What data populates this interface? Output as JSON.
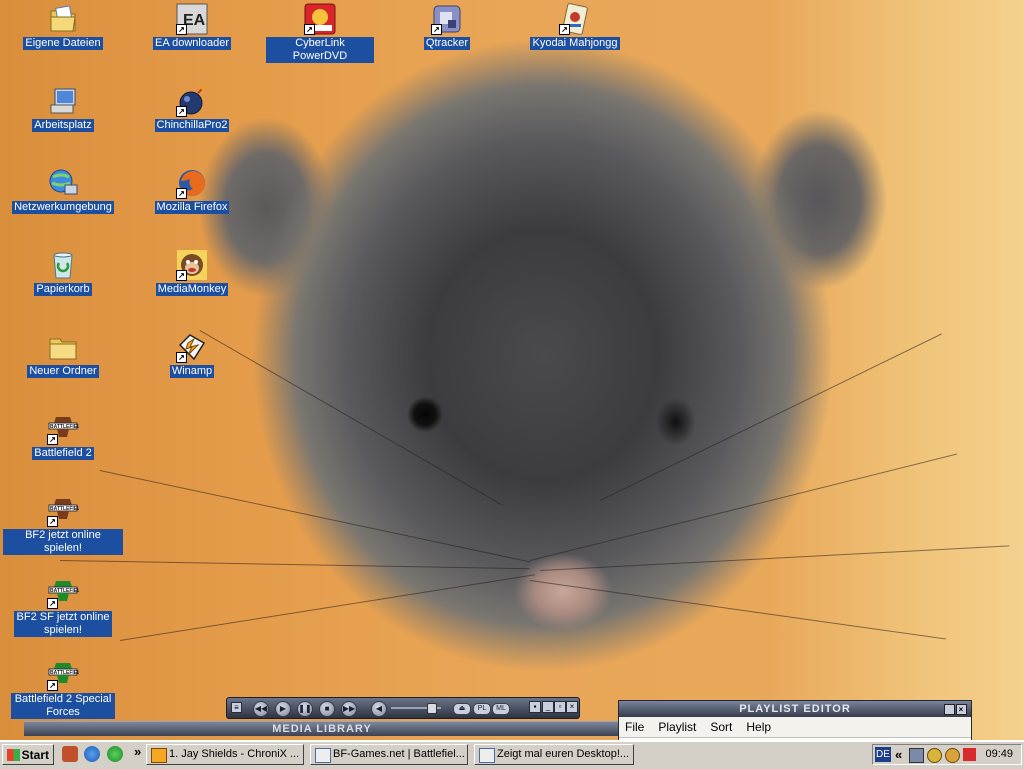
{
  "desktop": {
    "icons": [
      {
        "label": "Eigene Dateien",
        "icon": "my-documents-icon"
      },
      {
        "label": "EA downloader",
        "icon": "ea-icon"
      },
      {
        "label": "CyberLink PowerDVD",
        "icon": "powerdvd-icon"
      },
      {
        "label": "Qtracker",
        "icon": "qtracker-icon"
      },
      {
        "label": "Kyodai Mahjongg",
        "icon": "mahjongg-icon"
      },
      {
        "label": "Arbeitsplatz",
        "icon": "my-computer-icon"
      },
      {
        "label": "ChinchillaPro2",
        "icon": "bomb-icon"
      },
      {
        "label": "Netzwerkumgebung",
        "icon": "network-icon"
      },
      {
        "label": "Mozilla Firefox",
        "icon": "firefox-icon"
      },
      {
        "label": "Papierkorb",
        "icon": "recycle-bin-icon"
      },
      {
        "label": "MediaMonkey",
        "icon": "mediamonkey-icon"
      },
      {
        "label": "Neuer Ordner",
        "icon": "folder-icon"
      },
      {
        "label": "Winamp",
        "icon": "winamp-icon"
      },
      {
        "label": "Battlefield 2",
        "icon": "battlefield-icon"
      },
      {
        "label": "BF2 jetzt online spielen!",
        "icon": "battlefield-icon"
      },
      {
        "label": "BF2 SF jetzt online spielen!",
        "icon": "battlefield-sf-icon"
      },
      {
        "label": "Battlefield 2 Special Forces",
        "icon": "battlefield-sf-icon"
      }
    ]
  },
  "winamp": {
    "media_library_title": "MEDIA LIBRARY",
    "playlist_title": "PLAYLIST EDITOR",
    "playlist_menu": [
      "File",
      "Playlist",
      "Sort",
      "Help"
    ],
    "toggle_pl": "PL",
    "toggle_ml": "ML",
    "buttons": [
      "previous",
      "play",
      "pause",
      "stop",
      "next"
    ]
  },
  "taskbar": {
    "start_label": "Start",
    "more_label": "»",
    "tasks": [
      {
        "label": "1. Jay Shields - ChroniX ...",
        "icon": "winamp-task-icon"
      },
      {
        "label": "BF-Games.net | Battlefiel...",
        "icon": "browser-icon"
      },
      {
        "label": "Zeigt mal euren Desktop!...",
        "icon": "browser-icon"
      }
    ],
    "tray": {
      "language": "DE",
      "chevron": "«",
      "clock": "09:49"
    }
  },
  "colors": {
    "icon_label_bg": "#1d4fa0",
    "taskbar": "#d4d0c8"
  }
}
